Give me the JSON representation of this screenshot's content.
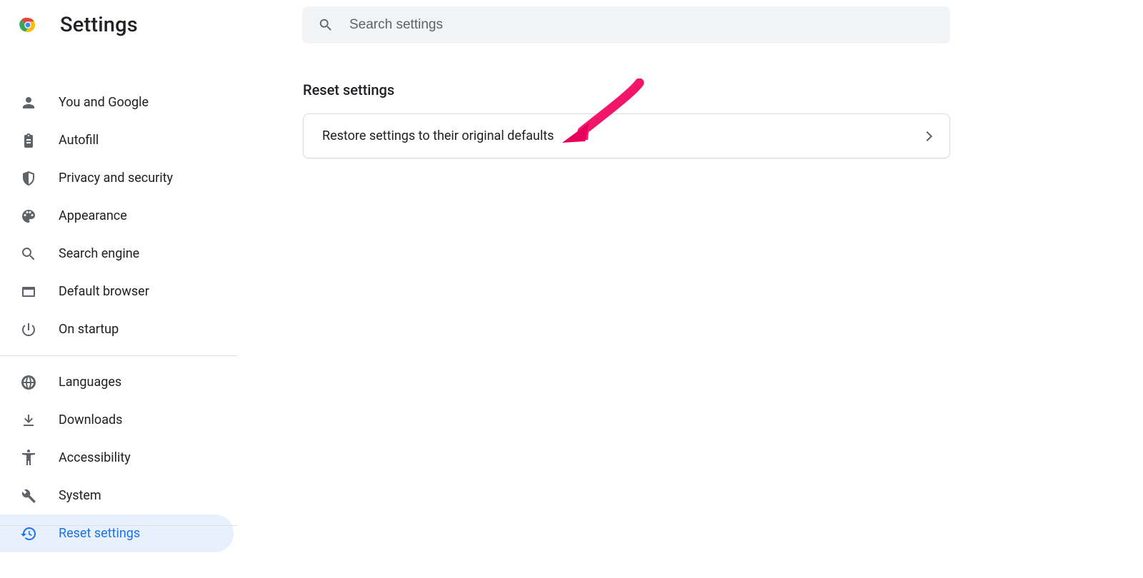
{
  "app": {
    "title": "Settings"
  },
  "search": {
    "placeholder": "Search settings"
  },
  "sidebar": {
    "groups": [
      {
        "items": [
          {
            "id": "you-google",
            "icon": "person",
            "label": "You and Google"
          },
          {
            "id": "autofill",
            "icon": "clipboard",
            "label": "Autofill"
          },
          {
            "id": "privacy",
            "icon": "shield",
            "label": "Privacy and security"
          },
          {
            "id": "appearance",
            "icon": "palette",
            "label": "Appearance"
          },
          {
            "id": "search-engine",
            "icon": "search",
            "label": "Search engine"
          },
          {
            "id": "default-browser",
            "icon": "window",
            "label": "Default browser"
          },
          {
            "id": "startup",
            "icon": "power",
            "label": "On startup"
          }
        ]
      },
      {
        "items": [
          {
            "id": "languages",
            "icon": "globe",
            "label": "Languages"
          },
          {
            "id": "downloads",
            "icon": "download",
            "label": "Downloads"
          },
          {
            "id": "accessibility",
            "icon": "accessibility",
            "label": "Accessibility"
          },
          {
            "id": "system",
            "icon": "wrench",
            "label": "System"
          },
          {
            "id": "reset",
            "icon": "history",
            "label": "Reset settings",
            "active": true
          }
        ]
      }
    ]
  },
  "main": {
    "section_title": "Reset settings",
    "card": {
      "label": "Restore settings to their original defaults"
    }
  }
}
